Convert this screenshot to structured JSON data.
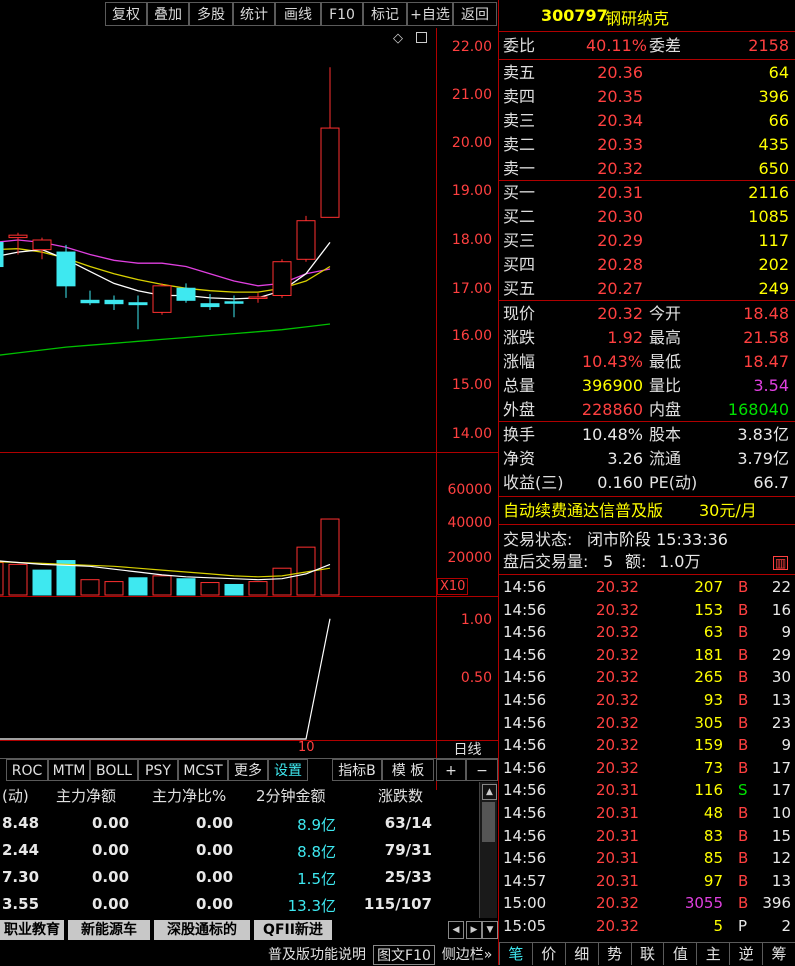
{
  "toolbar": {
    "buttons": [
      "复权",
      "叠加",
      "多股",
      "统计",
      "画线",
      "F10",
      "标记",
      "+自选",
      "返回"
    ]
  },
  "stock": {
    "code": "300797",
    "name": "钢研纳克"
  },
  "chart_data": [
    {
      "type": "candlestick",
      "title": "",
      "y_ticks": [
        "22.00",
        "21.00",
        "20.00",
        "19.00",
        "18.00",
        "17.00",
        "16.00",
        "15.00",
        "14.00"
      ],
      "ylim": [
        14.0,
        22.0
      ],
      "candles": [
        {
          "o": 17.95,
          "c": 17.45,
          "h": 18.25,
          "l": 17.4
        },
        {
          "o": 18.05,
          "c": 18.1,
          "h": 18.15,
          "l": 17.7
        },
        {
          "o": 17.8,
          "c": 18.0,
          "h": 18.05,
          "l": 17.6
        },
        {
          "o": 17.75,
          "c": 17.05,
          "h": 17.9,
          "l": 16.8
        },
        {
          "o": 16.75,
          "c": 16.7,
          "h": 16.95,
          "l": 16.65
        },
        {
          "o": 16.75,
          "c": 16.68,
          "h": 16.85,
          "l": 16.55
        },
        {
          "o": 16.7,
          "c": 16.66,
          "h": 16.85,
          "l": 16.15
        },
        {
          "o": 16.5,
          "c": 17.05,
          "h": 17.1,
          "l": 16.45
        },
        {
          "o": 17.0,
          "c": 16.75,
          "h": 17.1,
          "l": 16.7
        },
        {
          "o": 16.68,
          "c": 16.62,
          "h": 16.88,
          "l": 16.55
        },
        {
          "o": 16.72,
          "c": 16.7,
          "h": 16.85,
          "l": 16.4
        },
        {
          "o": 16.8,
          "c": 16.82,
          "h": 16.9,
          "l": 16.7
        },
        {
          "o": 16.85,
          "c": 17.55,
          "h": 17.6,
          "l": 16.8
        },
        {
          "o": 17.6,
          "c": 18.4,
          "h": 18.5,
          "l": 17.55
        },
        {
          "o": 18.47,
          "c": 20.32,
          "h": 21.58,
          "l": 18.47
        }
      ],
      "ma_fast": [
        17.65,
        17.75,
        17.8,
        17.6,
        17.35,
        17.1,
        16.95,
        16.85,
        16.85,
        16.8,
        16.78,
        16.8,
        16.95,
        17.3,
        17.95
      ],
      "ma_mid": [
        17.8,
        17.82,
        17.75,
        17.62,
        17.45,
        17.3,
        17.18,
        17.08,
        17.0,
        16.95,
        16.92,
        16.92,
        17.0,
        17.15,
        17.45
      ],
      "ma_slow": [
        17.95,
        18.0,
        17.95,
        17.85,
        17.7,
        17.58,
        17.52,
        17.52,
        17.45,
        17.3,
        17.15,
        17.05,
        17.1,
        17.3,
        17.4
      ],
      "ma_long": [
        15.6,
        15.66,
        15.72,
        15.78,
        15.82,
        15.86,
        15.9,
        15.94,
        15.98,
        16.02,
        16.06,
        16.1,
        16.14,
        16.2,
        16.26
      ]
    },
    {
      "type": "bar",
      "title": "",
      "y_ticks": [
        "60000",
        "40000",
        "20000"
      ],
      "multiplier": "X10",
      "ylim": [
        0,
        70000
      ],
      "values": [
        17000,
        16000,
        13000,
        18000,
        8000,
        7000,
        9000,
        10000,
        8500,
        6500,
        5500,
        7000,
        14000,
        25000,
        39690
      ],
      "up": [
        true,
        true,
        false,
        false,
        true,
        true,
        false,
        true,
        false,
        true,
        false,
        true,
        true,
        true,
        true
      ],
      "ma_a": [
        18000,
        17000,
        16000,
        15500,
        15000,
        13500,
        12000,
        10500,
        9500,
        9000,
        8500,
        8000,
        8500,
        11000,
        16000
      ],
      "ma_b": [
        17500,
        17000,
        16500,
        16000,
        15500,
        15000,
        14000,
        13000,
        12000,
        11000,
        10000,
        9500,
        10000,
        12000,
        14000
      ]
    },
    {
      "type": "line",
      "title": "",
      "y_ticks": [
        "1.00",
        "0.50"
      ],
      "ylim": [
        0,
        1.18
      ],
      "values": [
        0,
        0,
        0,
        0,
        0,
        0,
        0,
        0,
        0,
        0,
        0,
        0,
        0,
        0,
        1.0
      ],
      "x_label": "10"
    }
  ],
  "order_book": {
    "weibi_label": "委比",
    "weibi": "40.11%",
    "weicha_label": "委差",
    "weicha": "2158",
    "asks": [
      {
        "label": "卖五",
        "price": "20.36",
        "vol": "64"
      },
      {
        "label": "卖四",
        "price": "20.35",
        "vol": "396"
      },
      {
        "label": "卖三",
        "price": "20.34",
        "vol": "66"
      },
      {
        "label": "卖二",
        "price": "20.33",
        "vol": "435"
      },
      {
        "label": "卖一",
        "price": "20.32",
        "vol": "650"
      }
    ],
    "bids": [
      {
        "label": "买一",
        "price": "20.31",
        "vol": "2116"
      },
      {
        "label": "买二",
        "price": "20.30",
        "vol": "1085"
      },
      {
        "label": "买三",
        "price": "20.29",
        "vol": "117"
      },
      {
        "label": "买四",
        "price": "20.28",
        "vol": "202"
      },
      {
        "label": "买五",
        "price": "20.27",
        "vol": "249"
      }
    ]
  },
  "quote": {
    "rows": [
      {
        "l1": "现价",
        "v1": "20.32",
        "l2": "今开",
        "v2": "18.48"
      },
      {
        "l1": "涨跌",
        "v1": "1.92",
        "l2": "最高",
        "v2": "21.58"
      },
      {
        "l1": "涨幅",
        "v1": "10.43%",
        "l2": "最低",
        "v2": "18.47"
      },
      {
        "l1": "总量",
        "v1": "396900",
        "l2": "量比",
        "v2": "3.54"
      },
      {
        "l1": "外盘",
        "v1": "228860",
        "l2": "内盘",
        "v2": "168040"
      }
    ],
    "rows2": [
      {
        "l1": "换手",
        "v1": "10.48%",
        "l2": "股本",
        "v2": "3.83亿"
      },
      {
        "l1": "净资",
        "v1": "3.26",
        "l2": "流通",
        "v2": "3.79亿"
      },
      {
        "l1": "收益(三)",
        "v1": "0.160",
        "l2": "PE(动)",
        "v2": "66.7"
      }
    ]
  },
  "promo": {
    "text": "自动续费通达信普及版",
    "price": "30元/月"
  },
  "trade_status": {
    "line1_label": "交易状态:",
    "line1_value": "闭市阶段 15:33:36",
    "line2_label": "盘后交易量:",
    "line2_value": "5",
    "line2_label2": "额:",
    "line2_value2": "1.0万"
  },
  "ticks": [
    {
      "time": "14:56",
      "price": "20.32",
      "vol": "207",
      "dir": "B",
      "n": "22"
    },
    {
      "time": "14:56",
      "price": "20.32",
      "vol": "153",
      "dir": "B",
      "n": "16"
    },
    {
      "time": "14:56",
      "price": "20.32",
      "vol": "63",
      "dir": "B",
      "n": "9"
    },
    {
      "time": "14:56",
      "price": "20.32",
      "vol": "181",
      "dir": "B",
      "n": "29"
    },
    {
      "time": "14:56",
      "price": "20.32",
      "vol": "265",
      "dir": "B",
      "n": "30"
    },
    {
      "time": "14:56",
      "price": "20.32",
      "vol": "93",
      "dir": "B",
      "n": "13"
    },
    {
      "time": "14:56",
      "price": "20.32",
      "vol": "305",
      "dir": "B",
      "n": "23"
    },
    {
      "time": "14:56",
      "price": "20.32",
      "vol": "159",
      "dir": "B",
      "n": "9"
    },
    {
      "time": "14:56",
      "price": "20.32",
      "vol": "73",
      "dir": "B",
      "n": "17"
    },
    {
      "time": "14:56",
      "price": "20.31",
      "vol": "116",
      "dir": "S",
      "n": "17"
    },
    {
      "time": "14:56",
      "price": "20.31",
      "vol": "48",
      "dir": "B",
      "n": "10"
    },
    {
      "time": "14:56",
      "price": "20.31",
      "vol": "83",
      "dir": "B",
      "n": "15"
    },
    {
      "time": "14:56",
      "price": "20.31",
      "vol": "85",
      "dir": "B",
      "n": "12"
    },
    {
      "time": "14:57",
      "price": "20.31",
      "vol": "97",
      "dir": "B",
      "n": "13"
    },
    {
      "time": "15:00",
      "price": "20.32",
      "vol": "3055",
      "dir": "B",
      "n": "396"
    },
    {
      "time": "15:05",
      "price": "20.32",
      "vol": "5",
      "dir": "P",
      "n": "2"
    }
  ],
  "indicator_tabs": [
    "ROC",
    "MTM",
    "BOLL",
    "PSY",
    "MCST",
    "更多",
    "设置"
  ],
  "indicator_extra": {
    "zhibiao": "指标B",
    "moban": "模 板",
    "plus": "+",
    "minus": "−",
    "period": "日线"
  },
  "sector_table": {
    "headers": [
      "(动)",
      "主力净额",
      "主力净比%",
      "2分钟金额",
      "涨跌数"
    ],
    "rows": [
      {
        "c0": "8.48",
        "c1": "0.00",
        "c2": "0.00",
        "c3": "8.9亿",
        "c4": "63/14"
      },
      {
        "c0": "2.44",
        "c1": "0.00",
        "c2": "0.00",
        "c3": "8.8亿",
        "c4": "79/31"
      },
      {
        "c0": "7.30",
        "c1": "0.00",
        "c2": "0.00",
        "c3": "1.5亿",
        "c4": "25/33"
      },
      {
        "c0": "3.55",
        "c1": "0.00",
        "c2": "0.00",
        "c3": "13.3亿",
        "c4": "115/107"
      }
    ]
  },
  "sector_tabs": [
    "职业教育",
    "新能源车",
    "深股通标的",
    "QFII新进"
  ],
  "footer_tabs": [
    "普及版功能说明",
    "图文F10",
    "侧边栏»"
  ],
  "right_tabs": [
    "笔",
    "价",
    "细",
    "势",
    "联",
    "值",
    "主",
    "逆",
    "筹"
  ]
}
